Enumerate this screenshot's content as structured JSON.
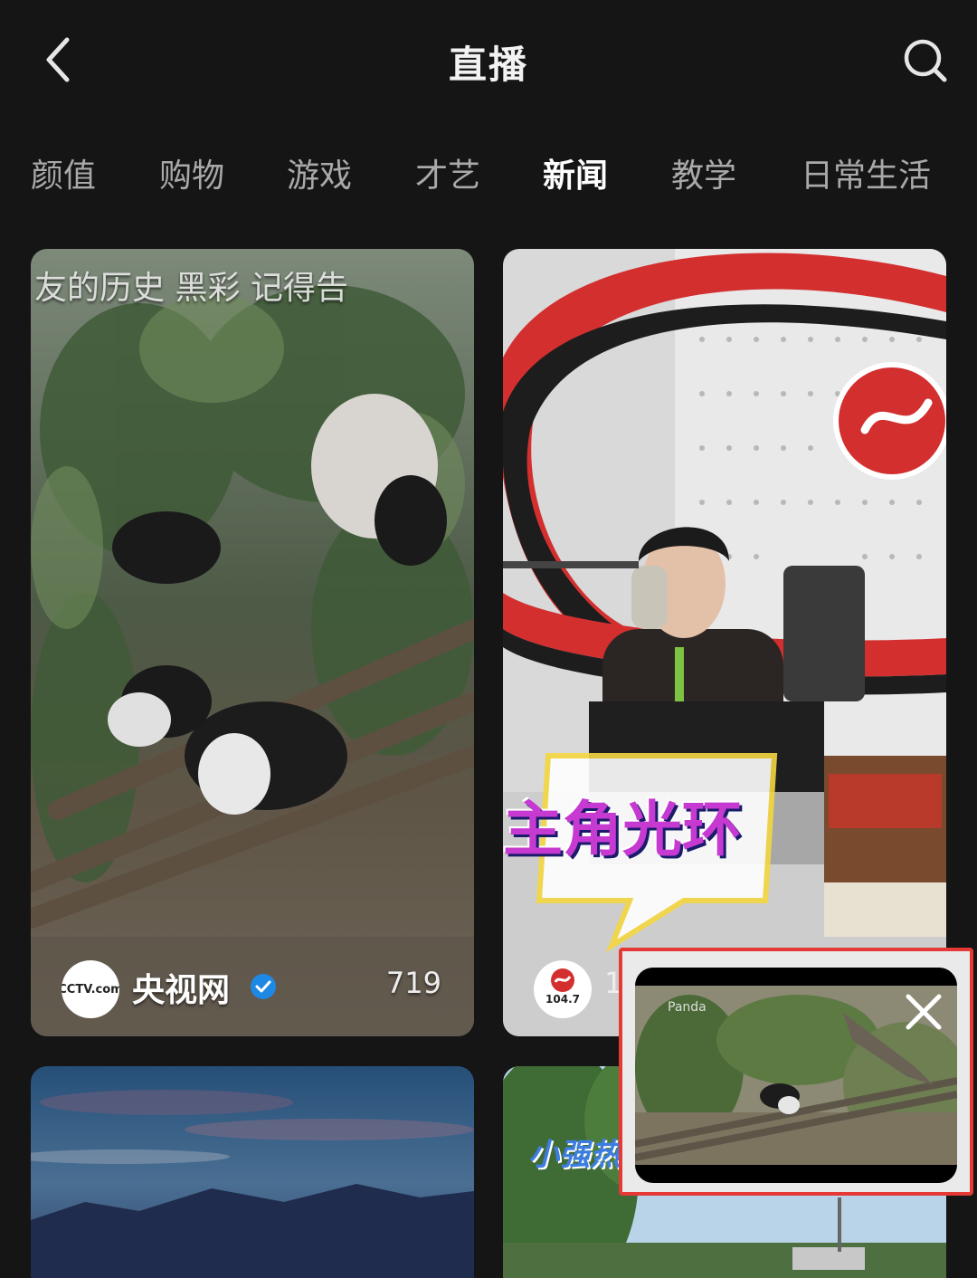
{
  "header": {
    "title": "直播",
    "back_icon": "chevron-left-icon",
    "search_icon": "search-icon"
  },
  "tabs": [
    {
      "label": "颜值",
      "active": false
    },
    {
      "label": "购物",
      "active": false
    },
    {
      "label": "游戏",
      "active": false
    },
    {
      "label": "才艺",
      "active": false
    },
    {
      "label": "新闻",
      "active": true
    },
    {
      "label": "教学",
      "active": false
    },
    {
      "label": "日常生活",
      "active": false
    }
  ],
  "cards": [
    {
      "caption": "友的历史  黑彩    记得告",
      "avatar_text": "CCTV.com",
      "channel": "央视网",
      "verified": true,
      "viewers": "719"
    },
    {
      "banner": "主角光环",
      "avatar_text": "104.7",
      "viewers": "1"
    },
    {},
    {
      "logo": "小强热"
    }
  ],
  "floating_player": {
    "label": "Panda",
    "close_icon": "close-icon"
  },
  "colors": {
    "background": "#151515",
    "active_tab": "#ffffff",
    "inactive_tab": "#a9a9a9",
    "highlight_border": "#e53935",
    "verified": "#1e88e5"
  }
}
